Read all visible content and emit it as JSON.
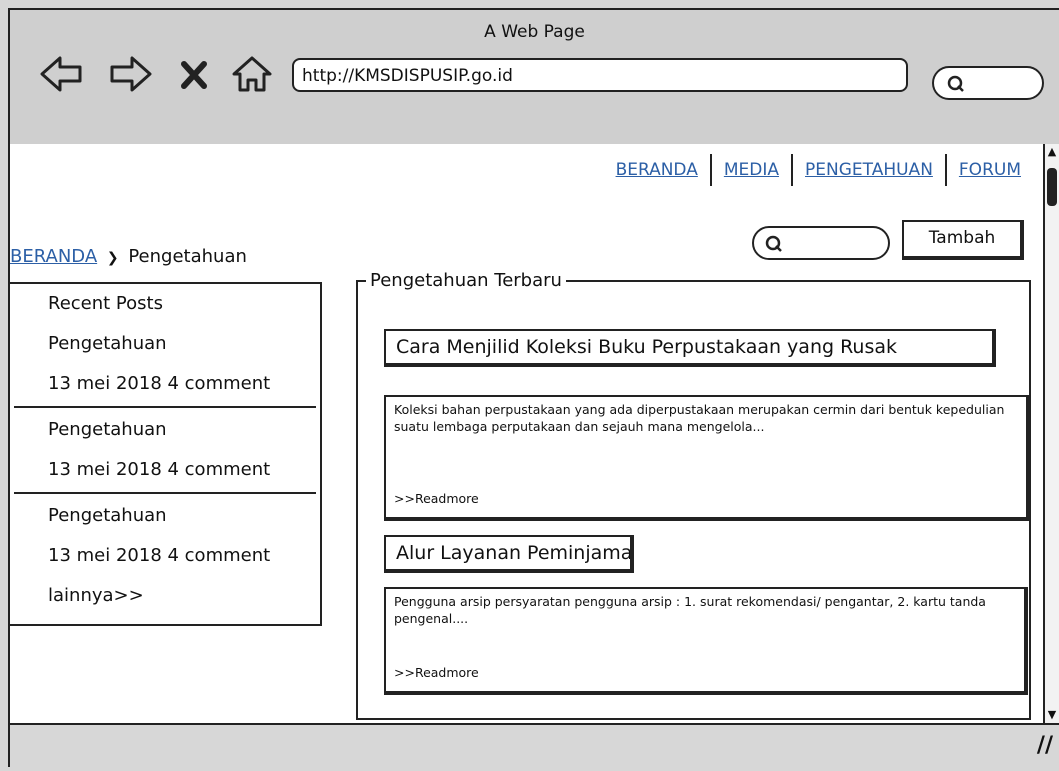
{
  "window": {
    "title": "A Web Page"
  },
  "browser": {
    "url": "http://KMSDISPUSIP.go.id"
  },
  "nav": {
    "items": [
      "BERANDA",
      "MEDIA",
      "PENGETAHUAN",
      "FORUM"
    ]
  },
  "breadcrumb": {
    "home": "BERANDA",
    "current": "Pengetahuan"
  },
  "actions": {
    "add_label": "Tambah"
  },
  "sidebar": {
    "heading": "Recent Posts",
    "posts": [
      {
        "title": "Pengetahuan",
        "meta": "13 mei 2018  4 comment"
      },
      {
        "title": "Pengetahuan",
        "meta": "13 mei 2018  4 comment"
      },
      {
        "title": "Pengetahuan",
        "meta": "13 mei 2018  4 comment"
      }
    ],
    "more": "lainnya>>"
  },
  "main": {
    "section_title": "Pengetahuan Terbaru",
    "posts": [
      {
        "title": "Cara Menjilid Koleksi Buku Perpustakaan yang Rusak",
        "excerpt": "Koleksi bahan perpustakaan yang ada diperpustakaan merupakan cermin dari bentuk kepedulian suatu lembaga perputakaan dan sejauh mana mengelola...",
        "readmore": ">>Readmore"
      },
      {
        "title": "Alur Layanan Peminjaman",
        "excerpt": "Pengguna arsip persyaratan pengguna arsip : 1. surat rekomendasi/ pengantar, 2. kartu tanda pengenal....",
        "readmore": ">>Readmore"
      }
    ]
  },
  "icons": [
    "back-arrow-icon",
    "forward-arrow-icon",
    "close-icon",
    "home-icon",
    "search-icon",
    "resize-grip-icon"
  ]
}
